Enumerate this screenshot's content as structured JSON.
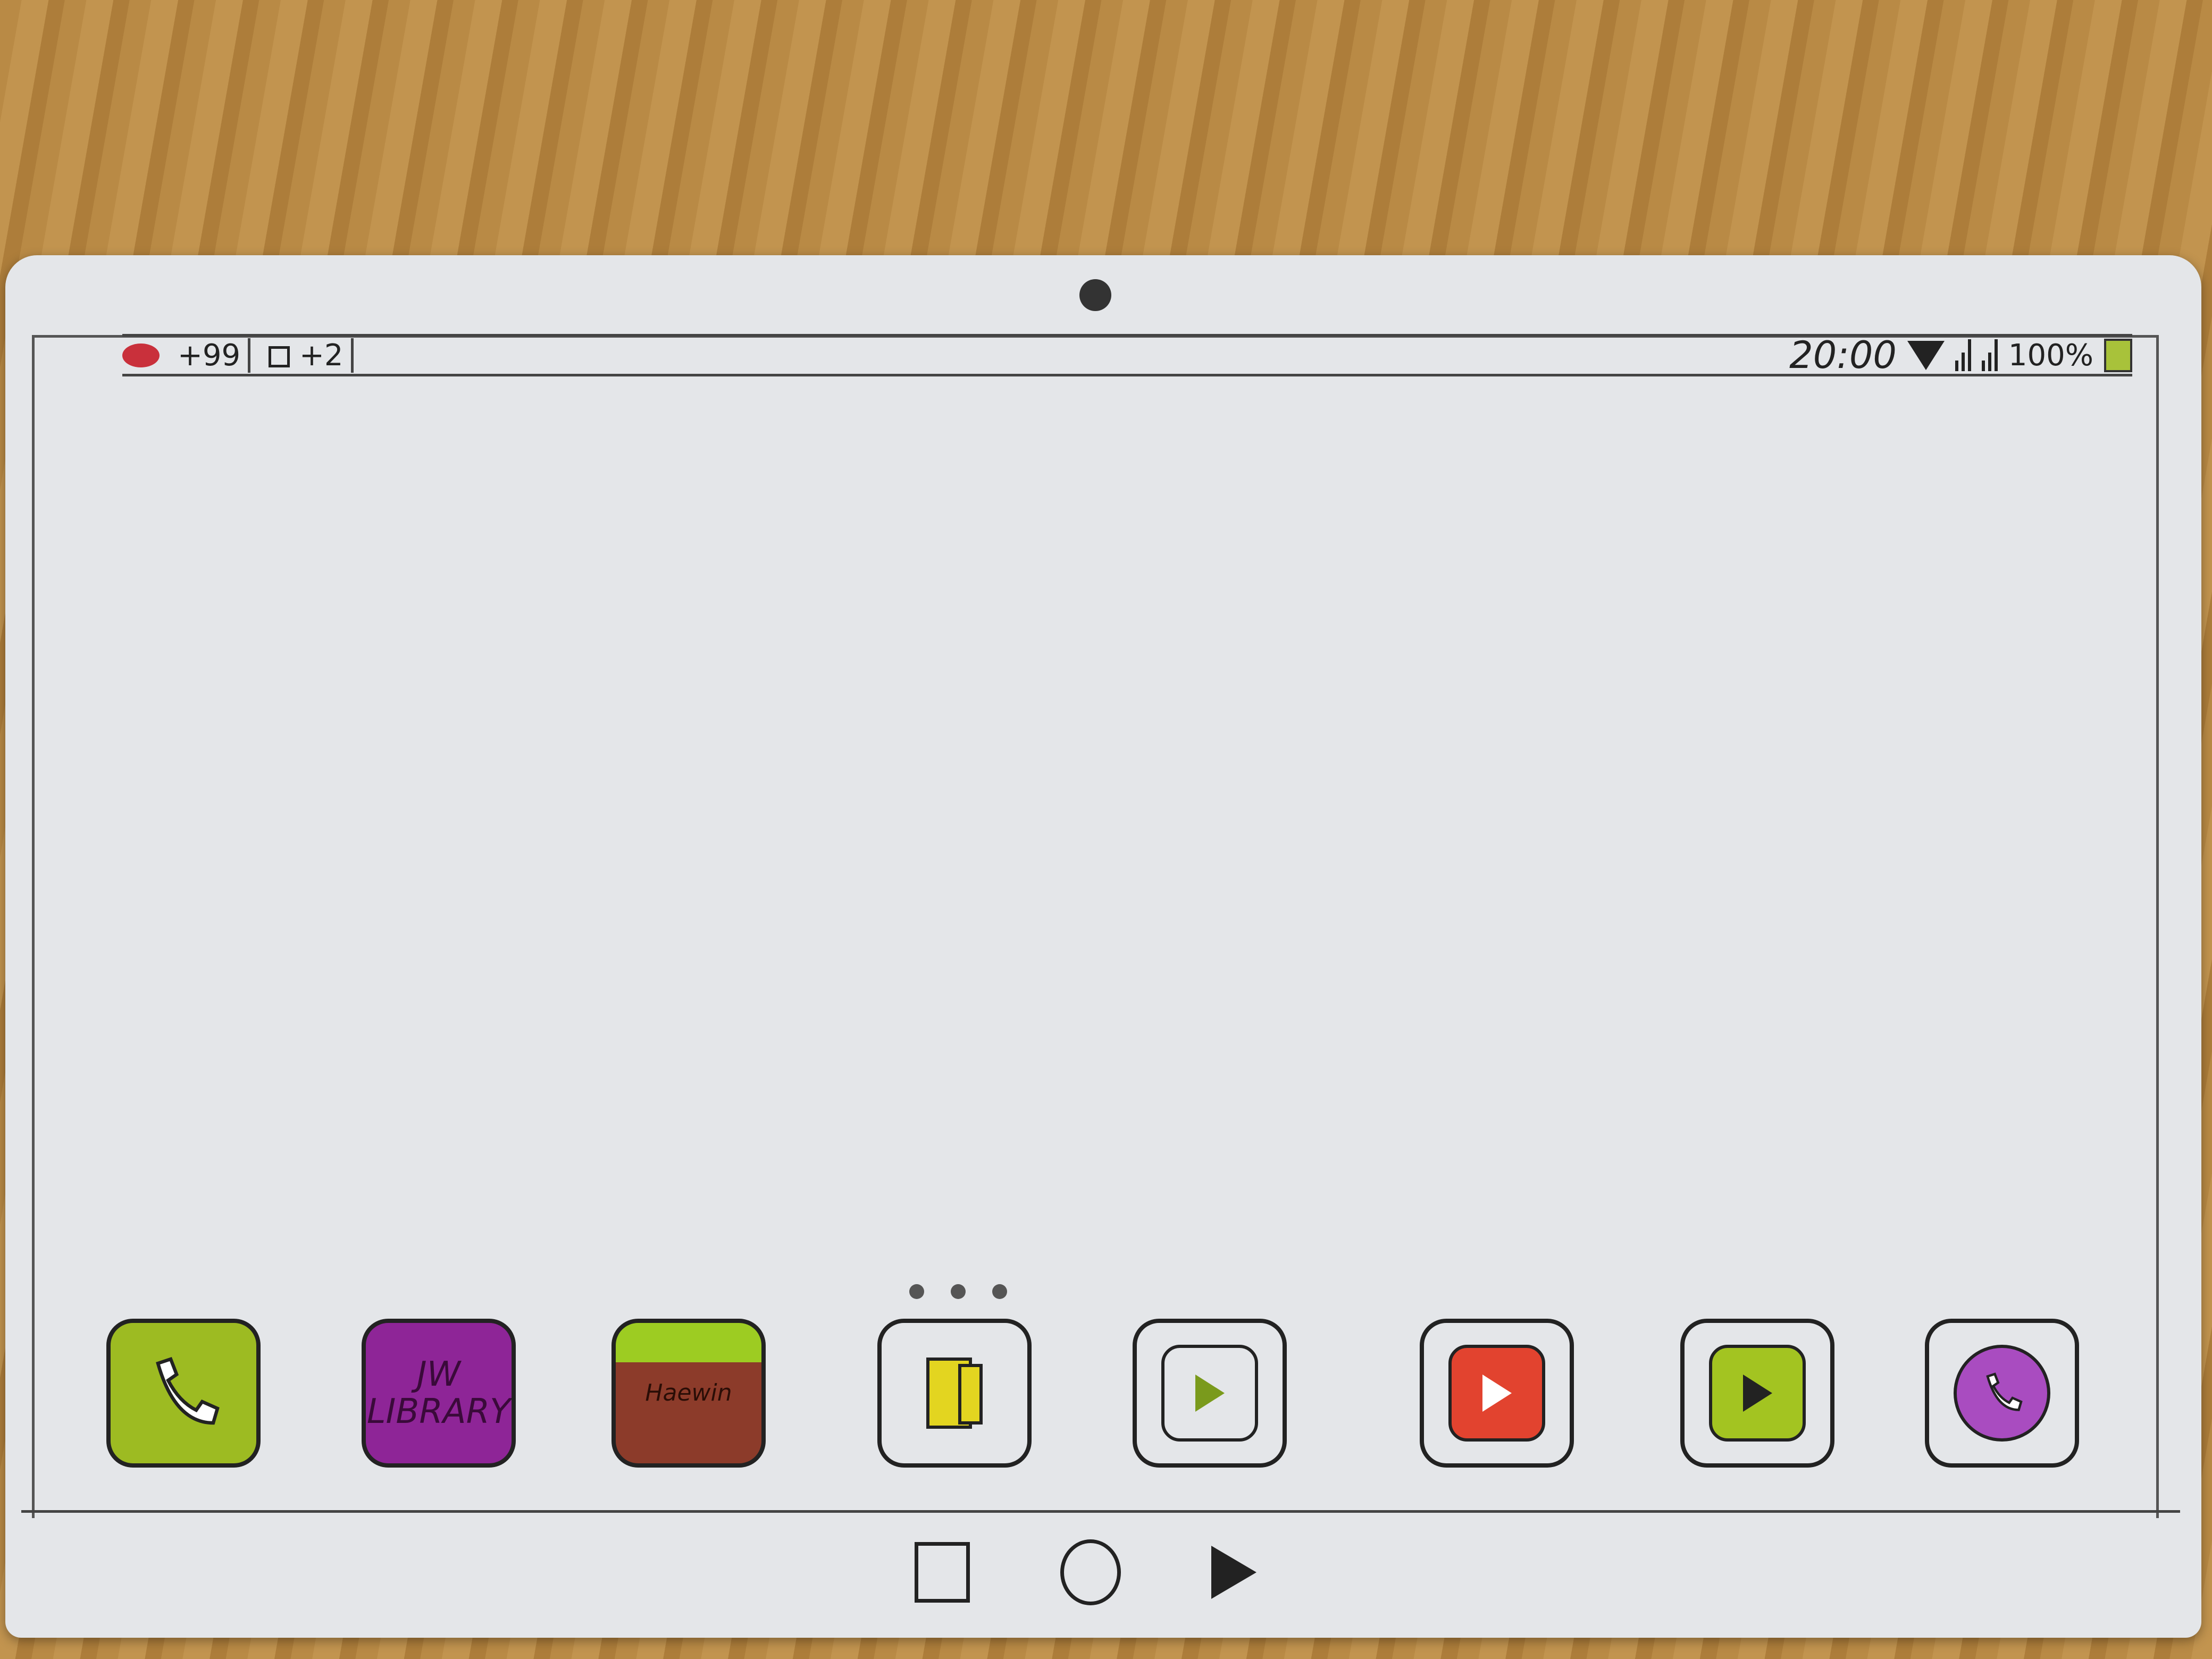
{
  "status_bar": {
    "notification_count": "+99",
    "second_notification": "+2",
    "time": "20:00",
    "battery": "100%",
    "colors": {
      "notification": "#c9303b",
      "battery": "#a8c23a"
    }
  },
  "page_indicator": {
    "dots": 3
  },
  "dock": {
    "apps": [
      {
        "name": "phone",
        "icon": "phone-icon",
        "color": "#9dbb22"
      },
      {
        "name": "jw-library",
        "label": "JW LIBRARY",
        "color": "#8e2597"
      },
      {
        "name": "game",
        "label": "Haewin",
        "color": "#8c3b2a",
        "top_color": "#9dcc22"
      },
      {
        "name": "files",
        "icon": "folder-icon",
        "color": "#e3d520"
      },
      {
        "name": "play-store",
        "icon": "shopping-bag-play-icon",
        "color": "#e4e6e9"
      },
      {
        "name": "youtube",
        "icon": "play-icon",
        "color": "#e2432f"
      },
      {
        "name": "video-player",
        "icon": "play-icon",
        "color": "#a3c421"
      },
      {
        "name": "viber",
        "icon": "phone-bubble-icon",
        "color": "#a94cc0"
      }
    ]
  },
  "nav_bar": {
    "buttons": [
      "recents",
      "home",
      "back"
    ]
  }
}
